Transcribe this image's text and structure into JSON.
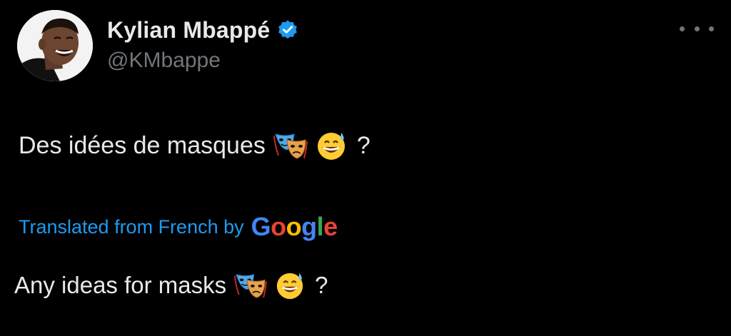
{
  "author": {
    "display_name": "Kylian Mbappé",
    "handle": "@KMbappe",
    "verified": true,
    "verified_color": "#1d9bf0"
  },
  "tweet": {
    "text": "Des idées de masques",
    "emojis": [
      "performing-arts-emoji",
      "grinning-sweat-emoji"
    ],
    "suffix": "?"
  },
  "translation": {
    "label": "Translated from French by",
    "provider_letters": [
      {
        "char": "G",
        "color": "#4285f4"
      },
      {
        "char": "o",
        "color": "#ea4335"
      },
      {
        "char": "o",
        "color": "#fbbc05"
      },
      {
        "char": "g",
        "color": "#4285f4"
      },
      {
        "char": "l",
        "color": "#34a853"
      },
      {
        "char": "e",
        "color": "#ea4335"
      }
    ],
    "text": "Any ideas for masks",
    "suffix": "?"
  },
  "colors": {
    "background": "#000000",
    "primary_text": "#e7e9ea",
    "secondary_text": "#71767b",
    "accent": "#1d9bf0"
  }
}
